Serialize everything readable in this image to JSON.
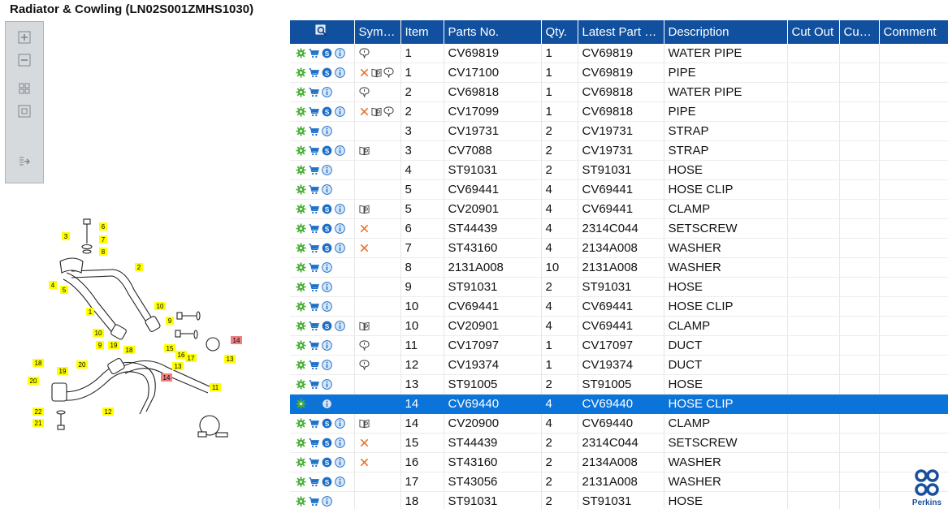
{
  "title": "Radiator & Cowling (LN02S001ZMHS1030)",
  "toolbar": {
    "buttons": [
      "zoom-in-icon",
      "zoom-out-icon",
      "fit-all-icon",
      "fit-window-icon",
      "export-icon"
    ]
  },
  "table": {
    "headers": [
      "Symb...",
      "Item",
      "Parts No.",
      "Qty.",
      "Latest Part No.",
      "Description",
      "Cut Out",
      "Cut In",
      "Comment"
    ],
    "rows": [
      {
        "s": true,
        "sym": [
          "t"
        ],
        "item": "1",
        "part": "CV69819",
        "qty": "1",
        "latest": "CV69819",
        "desc": "WATER PIPE"
      },
      {
        "s": true,
        "sym": [
          "x",
          "b",
          "t"
        ],
        "item": "1",
        "part": "CV17100",
        "qty": "1",
        "latest": "CV69819",
        "desc": "PIPE"
      },
      {
        "s": false,
        "sym": [
          "t"
        ],
        "item": "2",
        "part": "CV69818",
        "qty": "1",
        "latest": "CV69818",
        "desc": "WATER PIPE"
      },
      {
        "s": true,
        "sym": [
          "x",
          "b",
          "t"
        ],
        "item": "2",
        "part": "CV17099",
        "qty": "1",
        "latest": "CV69818",
        "desc": "PIPE"
      },
      {
        "s": false,
        "sym": [],
        "item": "3",
        "part": "CV19731",
        "qty": "2",
        "latest": "CV19731",
        "desc": "STRAP"
      },
      {
        "s": true,
        "sym": [
          "b"
        ],
        "item": "3",
        "part": "CV7088",
        "qty": "2",
        "latest": "CV19731",
        "desc": "STRAP"
      },
      {
        "s": false,
        "sym": [],
        "item": "4",
        "part": "ST91031",
        "qty": "2",
        "latest": "ST91031",
        "desc": "HOSE"
      },
      {
        "s": false,
        "sym": [],
        "item": "5",
        "part": "CV69441",
        "qty": "4",
        "latest": "CV69441",
        "desc": "HOSE CLIP"
      },
      {
        "s": true,
        "sym": [
          "b"
        ],
        "item": "5",
        "part": "CV20901",
        "qty": "4",
        "latest": "CV69441",
        "desc": "CLAMP"
      },
      {
        "s": true,
        "sym": [
          "x"
        ],
        "item": "6",
        "part": "ST44439",
        "qty": "4",
        "latest": "2314C044",
        "desc": "SETSCREW"
      },
      {
        "s": true,
        "sym": [
          "x"
        ],
        "item": "7",
        "part": "ST43160",
        "qty": "4",
        "latest": "2134A008",
        "desc": "WASHER"
      },
      {
        "s": false,
        "sym": [],
        "item": "8",
        "part": "2131A008",
        "qty": "10",
        "latest": "2131A008",
        "desc": "WASHER"
      },
      {
        "s": false,
        "sym": [],
        "item": "9",
        "part": "ST91031",
        "qty": "2",
        "latest": "ST91031",
        "desc": "HOSE"
      },
      {
        "s": false,
        "sym": [],
        "item": "10",
        "part": "CV69441",
        "qty": "4",
        "latest": "CV69441",
        "desc": "HOSE CLIP"
      },
      {
        "s": true,
        "sym": [
          "b"
        ],
        "item": "10",
        "part": "CV20901",
        "qty": "4",
        "latest": "CV69441",
        "desc": "CLAMP"
      },
      {
        "s": false,
        "sym": [
          "t"
        ],
        "item": "11",
        "part": "CV17097",
        "qty": "1",
        "latest": "CV17097",
        "desc": "DUCT"
      },
      {
        "s": false,
        "sym": [
          "t"
        ],
        "item": "12",
        "part": "CV19374",
        "qty": "1",
        "latest": "CV19374",
        "desc": "DUCT"
      },
      {
        "s": false,
        "sym": [],
        "item": "13",
        "part": "ST91005",
        "qty": "2",
        "latest": "ST91005",
        "desc": "HOSE"
      },
      {
        "s": false,
        "sym": [],
        "item": "14",
        "part": "CV69440",
        "qty": "4",
        "latest": "CV69440",
        "desc": "HOSE CLIP",
        "selected": true
      },
      {
        "s": true,
        "sym": [
          "b"
        ],
        "item": "14",
        "part": "CV20900",
        "qty": "4",
        "latest": "CV69440",
        "desc": "CLAMP"
      },
      {
        "s": true,
        "sym": [
          "x"
        ],
        "item": "15",
        "part": "ST44439",
        "qty": "2",
        "latest": "2314C044",
        "desc": "SETSCREW"
      },
      {
        "s": true,
        "sym": [
          "x"
        ],
        "item": "16",
        "part": "ST43160",
        "qty": "2",
        "latest": "2134A008",
        "desc": "WASHER"
      },
      {
        "s": true,
        "sym": [],
        "item": "17",
        "part": "ST43056",
        "qty": "2",
        "latest": "2131A008",
        "desc": "WASHER"
      },
      {
        "s": false,
        "sym": [],
        "item": "18",
        "part": "ST91031",
        "qty": "2",
        "latest": "ST91031",
        "desc": "HOSE"
      }
    ]
  },
  "drawing": {
    "callouts": [
      "1",
      "2",
      "3",
      "4",
      "5",
      "6",
      "7",
      "8",
      "9",
      "10",
      "11",
      "12",
      "13",
      "14",
      "15",
      "16",
      "17",
      "18",
      "19",
      "20",
      "21",
      "22"
    ]
  },
  "colors": {
    "header": "#10509f",
    "selected": "#0a74da",
    "callout": "#ffff00",
    "callout_alt": "#f08080"
  },
  "brand": "Perkins"
}
